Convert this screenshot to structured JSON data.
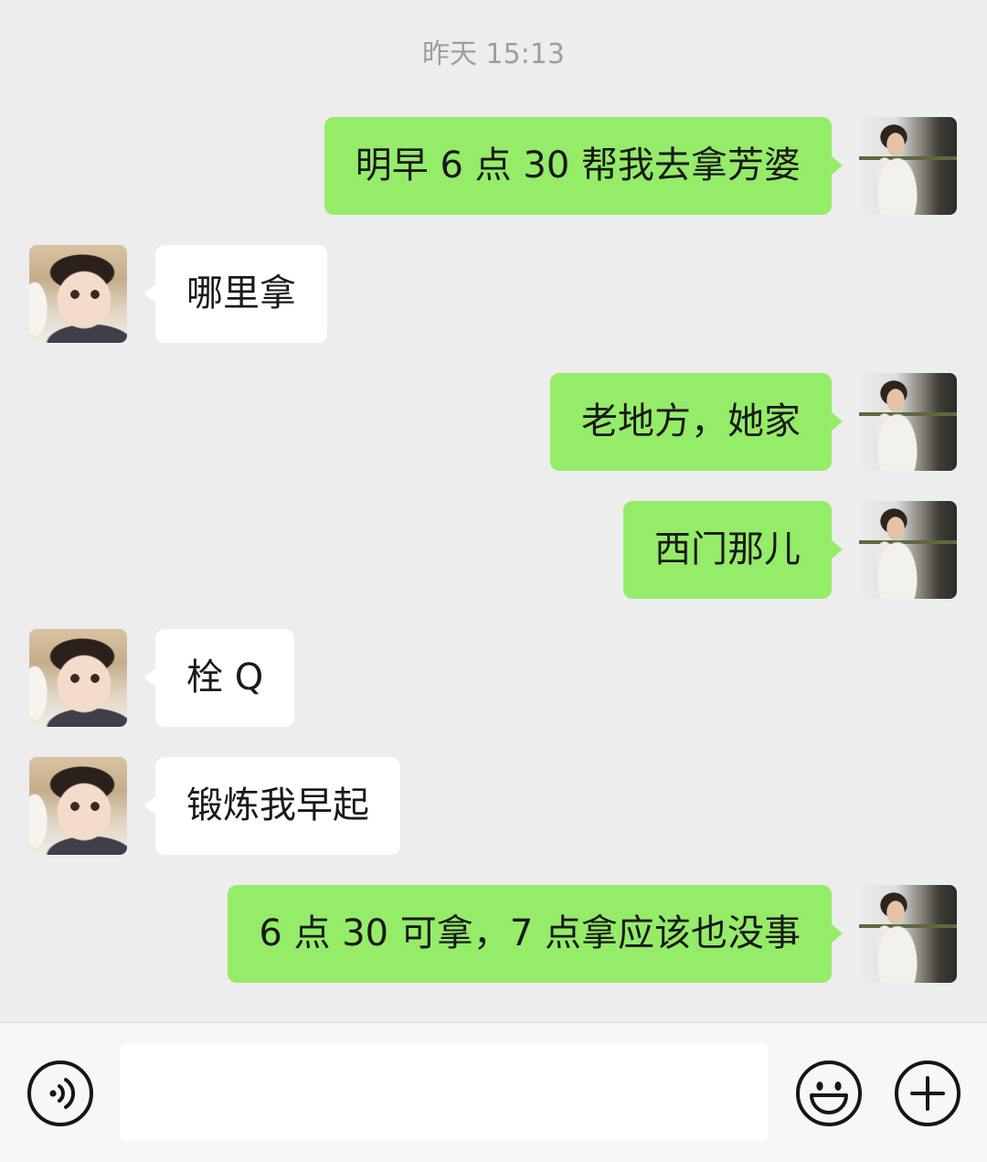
{
  "timestamp": "昨天 15:13",
  "messages": [
    {
      "outgoing": true,
      "text": "明早 6 点 30 帮我去拿芳婆"
    },
    {
      "outgoing": false,
      "text": "哪里拿"
    },
    {
      "outgoing": true,
      "text": "老地方，她家"
    },
    {
      "outgoing": true,
      "text": "西门那儿"
    },
    {
      "outgoing": false,
      "text": "栓 Q"
    },
    {
      "outgoing": false,
      "text": "锻炼我早起"
    },
    {
      "outgoing": true,
      "text": "6 点 30 可拿，7 点拿应该也没事"
    }
  ],
  "input_bar": {
    "input_value": "",
    "voice_icon": "voice-icon",
    "emoji_icon": "emoji-icon",
    "more_icon": "plus-icon"
  },
  "colors": {
    "background": "#ededed",
    "sent_bubble": "#95ec69",
    "received_bubble": "#ffffff",
    "timestamp_text": "#9e9e9e",
    "message_text": "#191919"
  }
}
